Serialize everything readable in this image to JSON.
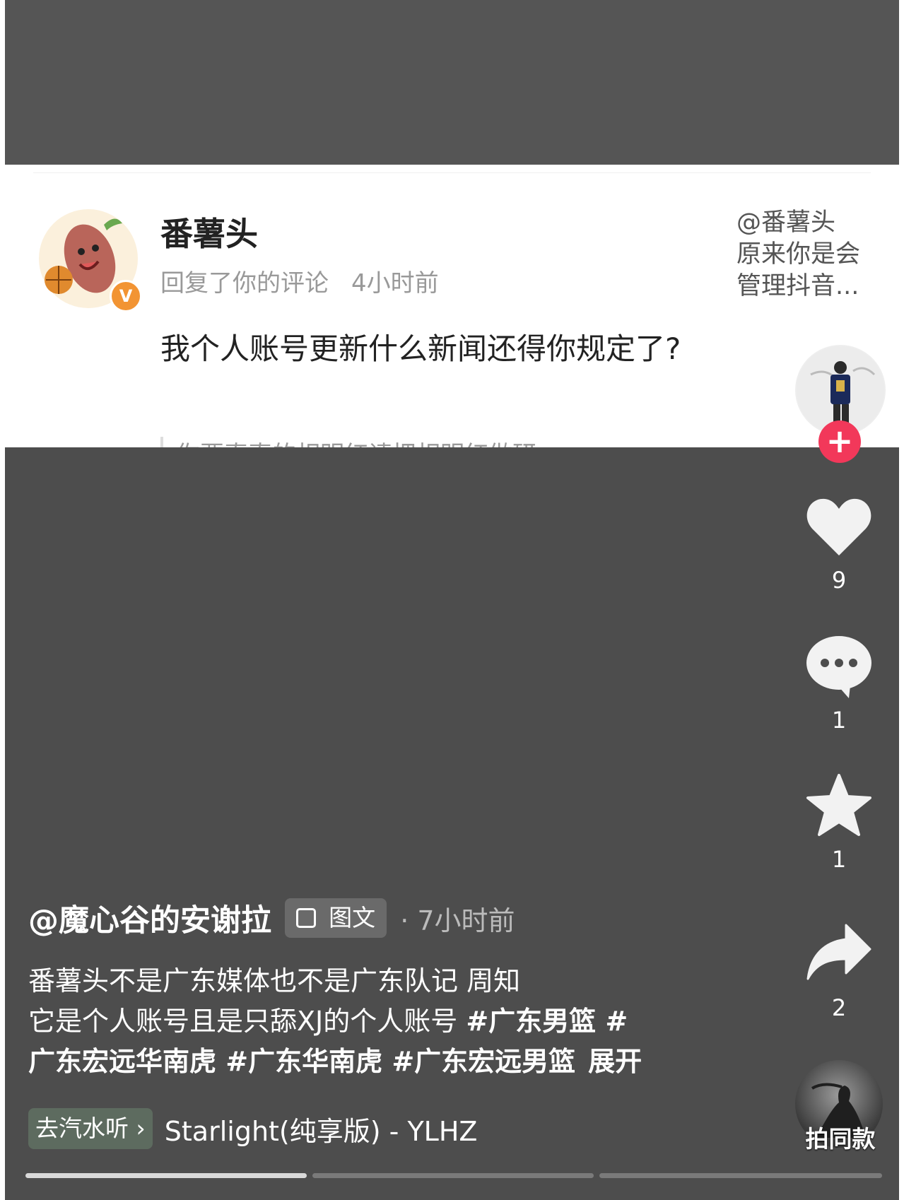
{
  "comment": {
    "username": "番薯头",
    "action": "回复了你的评论",
    "time": "4小时前",
    "text": "我个人账号更新什么新闻还得你规定了?",
    "reply_to_line1": "@番薯头",
    "reply_to_line2": "原来你是会",
    "reply_to_line3": "管理抖音...",
    "verified_mark": "V",
    "partial_text": "你要真真的相明红请把相明红做研"
  },
  "actions": {
    "follow_symbol": "+",
    "like_count": "9",
    "comment_count": "1",
    "favorite_count": "1",
    "share_count": "2",
    "same_style_label": "拍同款"
  },
  "post": {
    "author": "@魔心谷的安谢拉",
    "type_chip": "图文",
    "time": "· 7小时前",
    "desc_line1": "番薯头不是广东媒体也不是广东队记 周知",
    "desc_line2_text": "它是个人账号且是只舔XJ的个人账号 ",
    "hashtag1": "#广东男篮",
    "hashtag2_start": " #",
    "hashtag2_end": "广东宏远华南虎",
    "hashtag3": " #广东华南虎",
    "hashtag4": " #广东宏远男篮",
    "expand_label": "展开"
  },
  "music": {
    "chip_label": "去汽水听 ›",
    "title": "Starlight(纯享版) - YLHZ"
  },
  "colors": {
    "background": "#4d4d4d",
    "follow_red": "#f2385a",
    "verified_orange": "#f29433",
    "music_chip": "#5d6b5f"
  }
}
